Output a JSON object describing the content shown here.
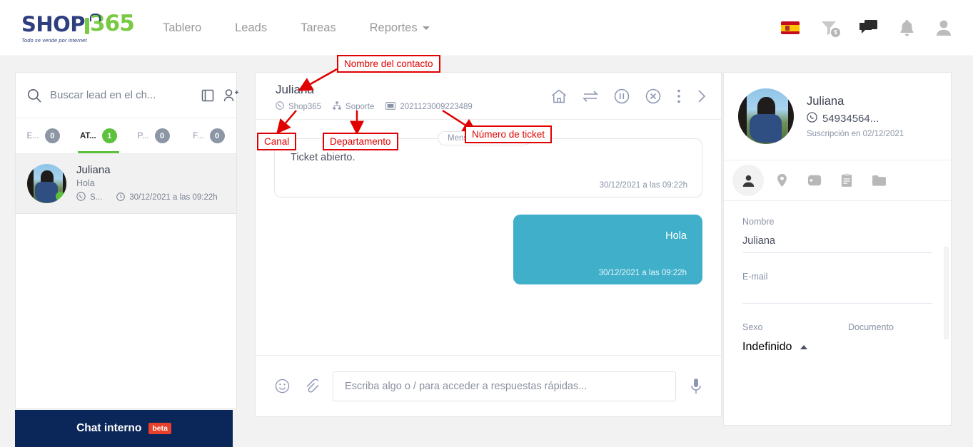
{
  "navbar": {
    "logo": {
      "shop": "SHOP",
      "num": "365",
      "tagline": "Todo se vende por internet"
    },
    "links": [
      {
        "label": "Tablero",
        "icon": ""
      },
      {
        "label": "Leads",
        "icon": ""
      },
      {
        "label": "Tareas",
        "icon": ""
      },
      {
        "label": "Reportes",
        "icon": "chevron-down-icon"
      }
    ],
    "right_icons": [
      {
        "name": "spain-flag-icon"
      },
      {
        "name": "funnel-money-icon",
        "badge": "$"
      },
      {
        "name": "chat-bubbles-icon"
      },
      {
        "name": "bell-icon"
      },
      {
        "name": "user-account-icon"
      }
    ]
  },
  "chat_list": {
    "search_placeholder": "Buscar lead en el ch...",
    "search_value": "",
    "icons": {
      "search": "search-icon",
      "book": "book-icon",
      "add_user": "add-user-icon"
    },
    "tabs": [
      {
        "label": "E...",
        "count": "0",
        "active": false
      },
      {
        "label": "AT...",
        "count": "1",
        "active": true
      },
      {
        "label": "P...",
        "count": "0",
        "active": false
      },
      {
        "label": "F...",
        "count": "0",
        "active": false
      }
    ],
    "items": [
      {
        "name": "Juliana",
        "preview": "Hola",
        "channel": "S...",
        "time": "30/12/2021 a las 09:22h"
      }
    ],
    "internal_chat": {
      "label": "Chat interno",
      "badge": "beta"
    }
  },
  "conversation": {
    "contact_name": "Juliana",
    "channel": "Shop365",
    "department": "Soporte",
    "ticket": "2021123009223489",
    "actions": [
      "home-icon",
      "transfer-icon",
      "pause-circle-icon",
      "close-circle-icon",
      "more-vertical-icon",
      "chevron-right-icon"
    ],
    "messages": [
      {
        "type": "incoming",
        "tag": "Mensaje automático",
        "text": "Ticket abierto.",
        "time": "30/12/2021 a las 09:22h"
      },
      {
        "type": "outgoing",
        "text": "Hola",
        "time": "30/12/2021 a las 09:22h"
      }
    ],
    "composer": {
      "placeholder": "Escriba algo o / para acceder a respuestas rápidas...",
      "value": "",
      "emoji_icon": "emoji-icon",
      "attach_icon": "paperclip-icon",
      "mic_icon": "microphone-icon"
    }
  },
  "details": {
    "contact": {
      "name": "Juliana",
      "phone": "54934564...",
      "subscription": "Suscripción en 02/12/2021"
    },
    "tabs": [
      {
        "name": "person-icon",
        "active": true
      },
      {
        "name": "location-pin-icon",
        "active": false
      },
      {
        "name": "tag-icon",
        "active": false
      },
      {
        "name": "clipboard-icon",
        "active": false
      },
      {
        "name": "folder-icon",
        "active": false
      }
    ],
    "fields": {
      "nombre_label": "Nombre",
      "nombre_value": "Juliana",
      "email_label": "E-mail",
      "email_value": "",
      "sexo_label": "Sexo",
      "sexo_value": "Indefinido",
      "documento_label": "Documento",
      "documento_value": ""
    }
  },
  "annotations": [
    {
      "label": "Nombre del contacto"
    },
    {
      "label": "Canal"
    },
    {
      "label": "Departamento"
    },
    {
      "label": "Número de ticket"
    }
  ],
  "colors": {
    "accent_green": "#5cc13b",
    "brand_blue": "#2e3e7e",
    "bubble_blue": "#3fafca",
    "annotation_red": "#e00000",
    "internal_navy": "#0b2659"
  }
}
